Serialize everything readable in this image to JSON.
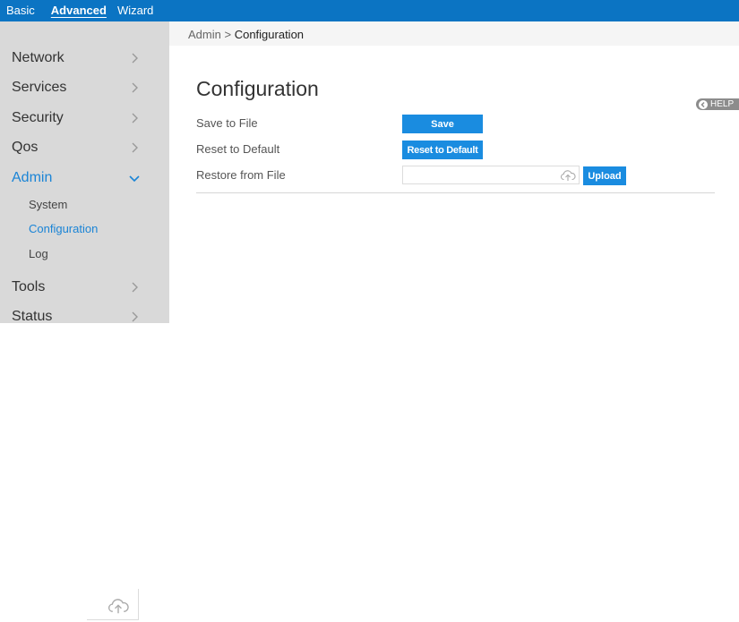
{
  "topnav": {
    "items": [
      {
        "label": "Basic",
        "active": false
      },
      {
        "label": "Advanced",
        "active": true
      },
      {
        "label": "Wizard",
        "active": false
      }
    ]
  },
  "sidebar": {
    "items": [
      {
        "label": "Network"
      },
      {
        "label": "Services"
      },
      {
        "label": "Security"
      },
      {
        "label": "Qos"
      },
      {
        "label": "Admin",
        "expanded": true,
        "active": true
      },
      {
        "label": "Tools"
      },
      {
        "label": "Status"
      }
    ],
    "admin_subitems": [
      {
        "label": "System"
      },
      {
        "label": "Configuration",
        "active": true
      },
      {
        "label": "Log"
      }
    ]
  },
  "breadcrumb": {
    "parent": "Admin",
    "separator": ">",
    "current": "Configuration"
  },
  "main": {
    "title": "Configuration",
    "help_label": "HELP",
    "rows": [
      {
        "label": "Save to File",
        "button": "Save"
      },
      {
        "label": "Reset to Default",
        "button": "Reset to Default"
      },
      {
        "label": "Restore from File",
        "button": "Upload",
        "file_value": ""
      }
    ]
  },
  "colors": {
    "topbar": "#0b74c3",
    "accent": "#1a8ce0",
    "active_text": "#1a84d6",
    "sidebar_bg": "#d9d9d9"
  },
  "icons": [
    "chevron-right-icon",
    "chevron-down-icon",
    "cloud-upload-icon",
    "help-back-icon"
  ]
}
